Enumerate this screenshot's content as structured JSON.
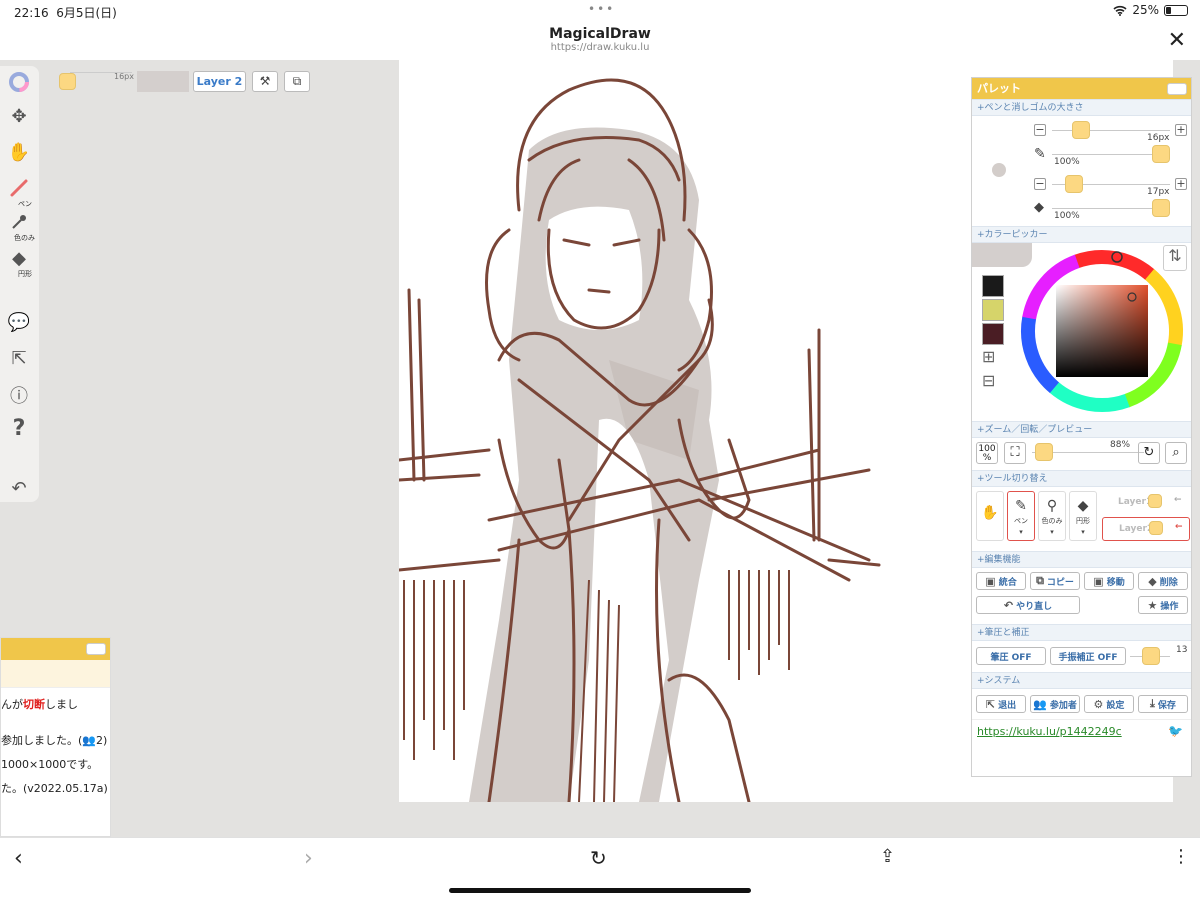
{
  "status_bar": {
    "time": "22:16",
    "date": "6月5日(日)",
    "dots": "•••",
    "battery": "25%",
    "battery_level": 0.25
  },
  "browser": {
    "title": "MagicalDraw",
    "url": "https://draw.kuku.lu",
    "close_icon": "close-icon"
  },
  "left_toolbar": {
    "items": [
      {
        "name": "color-wheel-icon"
      },
      {
        "name": "move-icon"
      },
      {
        "name": "hand-icon"
      },
      {
        "name": "pen-icon",
        "label": "ペン"
      },
      {
        "name": "eyedropper-icon",
        "label": "色のみ"
      },
      {
        "name": "eraser-icon",
        "label": "円形"
      },
      {
        "name": "chat-icon"
      },
      {
        "name": "exit-icon"
      },
      {
        "name": "info-icon"
      },
      {
        "name": "help-icon"
      },
      {
        "name": "undo-icon"
      }
    ]
  },
  "top_bar": {
    "size": "16px",
    "layer_label": "Layer 2"
  },
  "chat": {
    "lines": [
      {
        "pre": "んが",
        "em": "切断",
        "post": "しまし"
      },
      {
        "pre": "参加しました。(",
        "em": "",
        "post": "2)"
      },
      {
        "pre": "1000×1000です。",
        "em": "",
        "post": ""
      },
      {
        "pre": "た。(v2022.05.17a)",
        "em": "",
        "post": ""
      }
    ]
  },
  "palette": {
    "title": "パレット",
    "sections": {
      "size": "+ペンと消しゴムの大きさ",
      "picker": "+カラーピッカー",
      "zoom": "+ズーム／回転／プレビュー",
      "tool": "+ツール切り替え",
      "edit": "+編集機能",
      "pressure": "+筆圧と補正",
      "system": "+システム"
    },
    "pen_size": "16px",
    "pen_opacity": "100%",
    "eraser_size": "17px",
    "eraser_opacity": "100%",
    "zoom_value": "88%",
    "zoom_100": "100",
    "zoom_pct": "%",
    "tools": [
      {
        "name": "hand-tool",
        "label": ""
      },
      {
        "name": "pen-tool",
        "label": "ペン"
      },
      {
        "name": "eyedropper-tool",
        "label": "色のみ"
      },
      {
        "name": "eraser-tool",
        "label": "円形"
      }
    ],
    "layers": [
      "Layer1",
      "Layer2"
    ],
    "edit_buttons": {
      "merge": "統合",
      "copy": "コピー",
      "move": "移動",
      "delete": "削除",
      "redo": "やり直し",
      "operate": "操作"
    },
    "pressure": {
      "pressure_btn": "筆圧 OFF",
      "stabilizer_btn": "手振補正 OFF",
      "value": "13"
    },
    "system_buttons": {
      "exit": "退出",
      "members": "参加者",
      "settings": "設定",
      "save": "保存"
    },
    "link": "https://kuku.lu/p1442249c"
  },
  "colors": {
    "accent": "#f0c64a",
    "knob": "#fcd882",
    "stroke": "#7a4638",
    "swatch1": "#1a1a1a",
    "swatch2": "#d6d46a",
    "swatch3": "#4a1d24"
  }
}
